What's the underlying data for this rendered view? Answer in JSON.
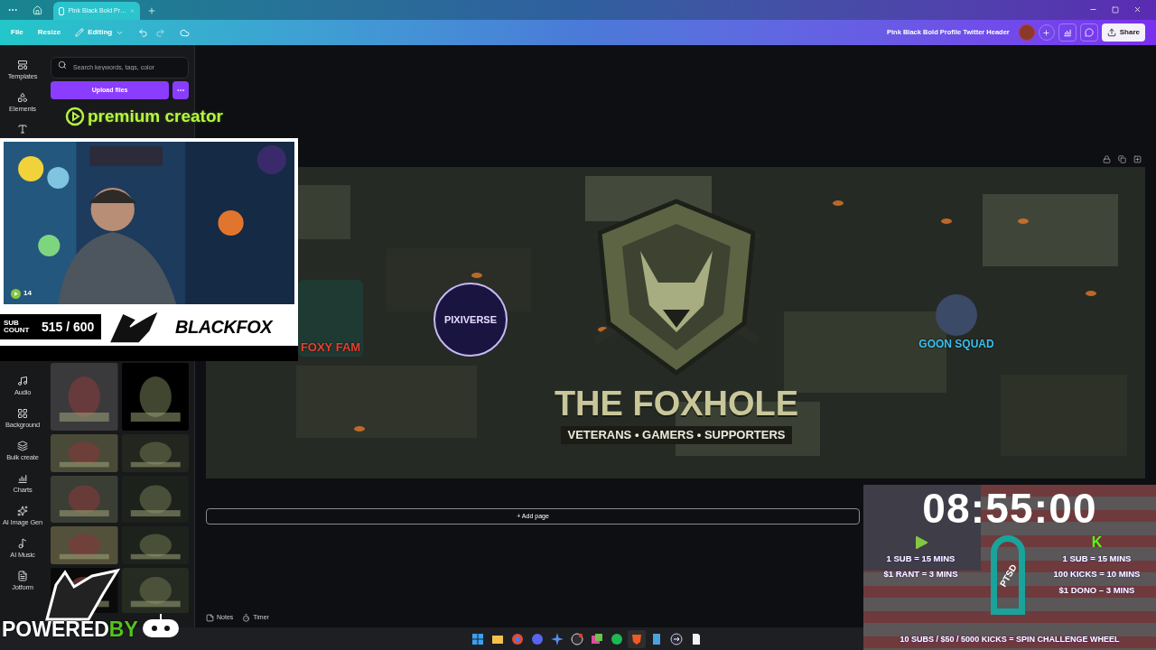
{
  "browser": {
    "tab_title": "Pink Black Bold Pr…"
  },
  "toolbar": {
    "menu": [
      "File",
      "Resize"
    ],
    "mode": "Editing",
    "title": "Pink Black Bold Profile Twitter Header",
    "share": "Share"
  },
  "rail": {
    "top": [
      "Templates",
      "Elements"
    ],
    "bottom": [
      "Audio",
      "Background",
      "Bulk create",
      "Charts",
      "AI Image Gen",
      "AI Music",
      "Jotform"
    ]
  },
  "panel": {
    "search": {
      "placeholder": "Search keywords, tags, color"
    },
    "upload": "Upload files"
  },
  "design": {
    "title": "THE FOXHOLE",
    "tagline": "VETERANS • GAMERS • SUPPORTERS",
    "logos": [
      "FOXY FAM",
      "PIXIVERSE",
      "GOON SQUAD"
    ]
  },
  "add_page": "+ Add page",
  "footer": [
    "Notes",
    "Timer"
  ],
  "overlays": {
    "premium": "premium creator",
    "webcam": {
      "viewers": "14",
      "sub_label": "SUB COUNT",
      "sub_count": "515 / 600",
      "brand": "BLACKFOX"
    },
    "timer": {
      "clock": "08:55:00",
      "rumble": [
        "1 SUB = 15 MINS",
        "$1 RANT = 3 MINS"
      ],
      "kick_mark": "K",
      "kick": [
        "1 SUB = 15 MINS",
        "100 KICKS = 10 MINS",
        "$1 DONO – 3 MINS"
      ],
      "ribbon": "PTSD",
      "footer": "10 SUBS / $50 / 5000 KICKS = SPIN CHALLENGE WHEEL"
    },
    "powered": [
      "POWERED",
      "BY"
    ]
  }
}
